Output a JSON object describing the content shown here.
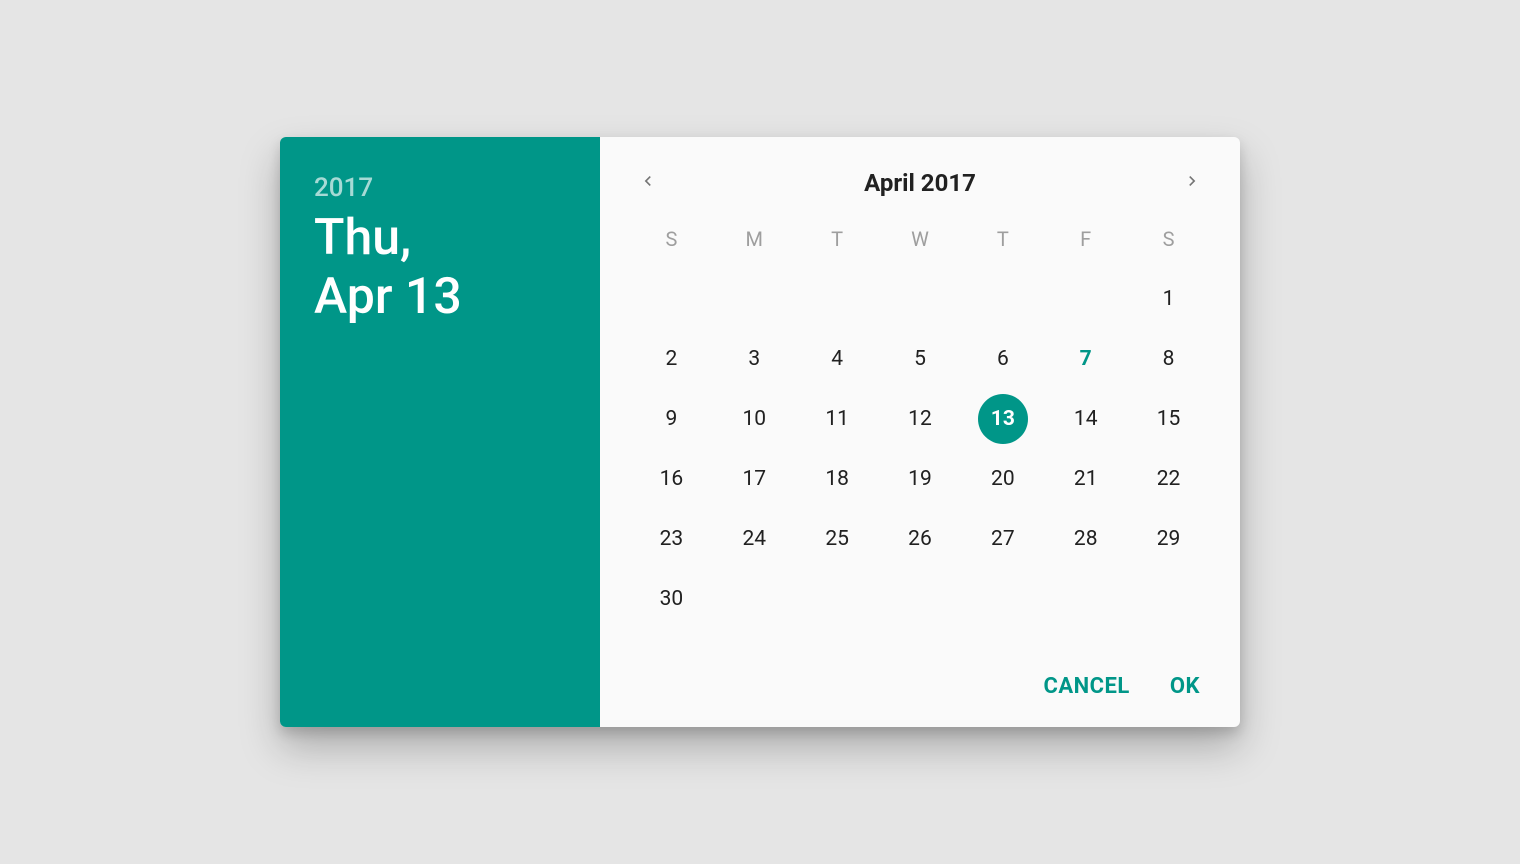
{
  "accent": "#009688",
  "side": {
    "year": "2017",
    "date_line1": "Thu,",
    "date_line2": "Apr 13"
  },
  "month": {
    "label": "April 2017"
  },
  "weekdays": [
    "S",
    "M",
    "T",
    "W",
    "T",
    "F",
    "S"
  ],
  "calendar": {
    "leading_blanks": 6,
    "days_in_month": 30,
    "today": 7,
    "selected": 13
  },
  "actions": {
    "cancel": "CANCEL",
    "ok": "OK"
  }
}
